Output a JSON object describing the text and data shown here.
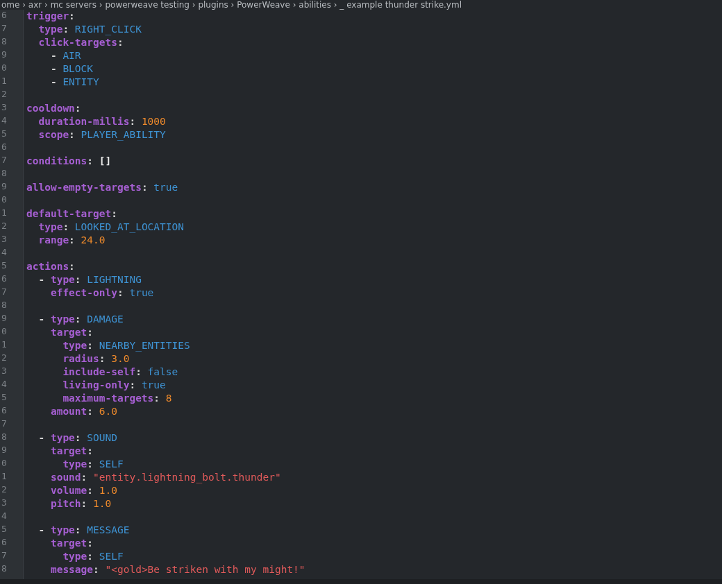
{
  "breadcrumb": "ome › axr › mc servers › powerweave testing › plugins › PowerWeave › abilities › _ example thunder strike.yml",
  "lines": [
    {
      "number": "6",
      "tokens": [
        {
          "kind": "key",
          "text": "trigger"
        },
        {
          "kind": "punct",
          "text": ":"
        }
      ]
    },
    {
      "number": "7",
      "tokens": [
        {
          "kind": "key",
          "text": "  type"
        },
        {
          "kind": "punct",
          "text": ": "
        },
        {
          "kind": "value",
          "text": "RIGHT_CLICK"
        }
      ]
    },
    {
      "number": "8",
      "tokens": [
        {
          "kind": "key",
          "text": "  click-targets"
        },
        {
          "kind": "punct",
          "text": ":"
        }
      ]
    },
    {
      "number": "9",
      "tokens": [
        {
          "kind": "punct",
          "text": "    - "
        },
        {
          "kind": "value",
          "text": "AIR"
        }
      ]
    },
    {
      "number": "0",
      "tokens": [
        {
          "kind": "punct",
          "text": "    - "
        },
        {
          "kind": "value",
          "text": "BLOCK"
        }
      ]
    },
    {
      "number": "1",
      "tokens": [
        {
          "kind": "punct",
          "text": "    - "
        },
        {
          "kind": "value",
          "text": "ENTITY"
        }
      ]
    },
    {
      "number": "2"
    },
    {
      "number": "3",
      "tokens": [
        {
          "kind": "key",
          "text": "cooldown"
        },
        {
          "kind": "punct",
          "text": ":"
        }
      ]
    },
    {
      "number": "4",
      "tokens": [
        {
          "kind": "key",
          "text": "  duration-millis"
        },
        {
          "kind": "punct",
          "text": ": "
        },
        {
          "kind": "number",
          "text": "1000"
        }
      ]
    },
    {
      "number": "5",
      "tokens": [
        {
          "kind": "key",
          "text": "  scope"
        },
        {
          "kind": "punct",
          "text": ": "
        },
        {
          "kind": "value",
          "text": "PLAYER_ABILITY"
        }
      ]
    },
    {
      "number": "6"
    },
    {
      "number": "7",
      "tokens": [
        {
          "kind": "key",
          "text": "conditions"
        },
        {
          "kind": "punct",
          "text": ": "
        },
        {
          "kind": "bracket",
          "text": "[]"
        }
      ]
    },
    {
      "number": "8"
    },
    {
      "number": "9",
      "tokens": [
        {
          "kind": "key",
          "text": "allow-empty-targets"
        },
        {
          "kind": "punct",
          "text": ": "
        },
        {
          "kind": "value",
          "text": "true"
        }
      ]
    },
    {
      "number": "0"
    },
    {
      "number": "1",
      "tokens": [
        {
          "kind": "key",
          "text": "default-target"
        },
        {
          "kind": "punct",
          "text": ":"
        }
      ]
    },
    {
      "number": "2",
      "tokens": [
        {
          "kind": "key",
          "text": "  type"
        },
        {
          "kind": "punct",
          "text": ": "
        },
        {
          "kind": "value",
          "text": "LOOKED_AT_LOCATION"
        }
      ]
    },
    {
      "number": "3",
      "tokens": [
        {
          "kind": "key",
          "text": "  range"
        },
        {
          "kind": "punct",
          "text": ": "
        },
        {
          "kind": "number",
          "text": "24.0"
        }
      ]
    },
    {
      "number": "4"
    },
    {
      "number": "5",
      "tokens": [
        {
          "kind": "key",
          "text": "actions"
        },
        {
          "kind": "punct",
          "text": ":"
        }
      ]
    },
    {
      "number": "6",
      "tokens": [
        {
          "kind": "punct",
          "text": "  - "
        },
        {
          "kind": "key",
          "text": "type"
        },
        {
          "kind": "punct",
          "text": ": "
        },
        {
          "kind": "value",
          "text": "LIGHTNING"
        }
      ]
    },
    {
      "number": "7",
      "tokens": [
        {
          "kind": "key",
          "text": "    effect-only"
        },
        {
          "kind": "punct",
          "text": ": "
        },
        {
          "kind": "value",
          "text": "true"
        }
      ]
    },
    {
      "number": "8"
    },
    {
      "number": "9",
      "tokens": [
        {
          "kind": "punct",
          "text": "  - "
        },
        {
          "kind": "key",
          "text": "type"
        },
        {
          "kind": "punct",
          "text": ": "
        },
        {
          "kind": "value",
          "text": "DAMAGE"
        }
      ]
    },
    {
      "number": "0",
      "tokens": [
        {
          "kind": "key",
          "text": "    target"
        },
        {
          "kind": "punct",
          "text": ":"
        }
      ]
    },
    {
      "number": "1",
      "tokens": [
        {
          "kind": "key",
          "text": "      type"
        },
        {
          "kind": "punct",
          "text": ": "
        },
        {
          "kind": "value",
          "text": "NEARBY_ENTITIES"
        }
      ]
    },
    {
      "number": "2",
      "tokens": [
        {
          "kind": "key",
          "text": "      radius"
        },
        {
          "kind": "punct",
          "text": ": "
        },
        {
          "kind": "number",
          "text": "3.0"
        }
      ]
    },
    {
      "number": "3",
      "tokens": [
        {
          "kind": "key",
          "text": "      include-self"
        },
        {
          "kind": "punct",
          "text": ": "
        },
        {
          "kind": "value",
          "text": "false"
        }
      ]
    },
    {
      "number": "4",
      "tokens": [
        {
          "kind": "key",
          "text": "      living-only"
        },
        {
          "kind": "punct",
          "text": ": "
        },
        {
          "kind": "value",
          "text": "true"
        }
      ]
    },
    {
      "number": "5",
      "tokens": [
        {
          "kind": "key",
          "text": "      maximum-targets"
        },
        {
          "kind": "punct",
          "text": ": "
        },
        {
          "kind": "number",
          "text": "8"
        }
      ]
    },
    {
      "number": "6",
      "tokens": [
        {
          "kind": "key",
          "text": "    amount"
        },
        {
          "kind": "punct",
          "text": ": "
        },
        {
          "kind": "number",
          "text": "6.0"
        }
      ]
    },
    {
      "number": "7"
    },
    {
      "number": "8",
      "tokens": [
        {
          "kind": "punct",
          "text": "  - "
        },
        {
          "kind": "key",
          "text": "type"
        },
        {
          "kind": "punct",
          "text": ": "
        },
        {
          "kind": "value",
          "text": "SOUND"
        }
      ]
    },
    {
      "number": "9",
      "tokens": [
        {
          "kind": "key",
          "text": "    target"
        },
        {
          "kind": "punct",
          "text": ":"
        }
      ]
    },
    {
      "number": "0",
      "tokens": [
        {
          "kind": "key",
          "text": "      type"
        },
        {
          "kind": "punct",
          "text": ": "
        },
        {
          "kind": "value",
          "text": "SELF"
        }
      ]
    },
    {
      "number": "1",
      "tokens": [
        {
          "kind": "key",
          "text": "    sound"
        },
        {
          "kind": "punct",
          "text": ": "
        },
        {
          "kind": "string",
          "text": "\"entity.lightning_bolt.thunder\""
        }
      ]
    },
    {
      "number": "2",
      "tokens": [
        {
          "kind": "key",
          "text": "    volume"
        },
        {
          "kind": "punct",
          "text": ": "
        },
        {
          "kind": "number",
          "text": "1.0"
        }
      ]
    },
    {
      "number": "3",
      "tokens": [
        {
          "kind": "key",
          "text": "    pitch"
        },
        {
          "kind": "punct",
          "text": ": "
        },
        {
          "kind": "number",
          "text": "1.0"
        }
      ]
    },
    {
      "number": "4"
    },
    {
      "number": "5",
      "tokens": [
        {
          "kind": "punct",
          "text": "  - "
        },
        {
          "kind": "key",
          "text": "type"
        },
        {
          "kind": "punct",
          "text": ": "
        },
        {
          "kind": "value",
          "text": "MESSAGE"
        }
      ]
    },
    {
      "number": "6",
      "tokens": [
        {
          "kind": "key",
          "text": "    target"
        },
        {
          "kind": "punct",
          "text": ":"
        }
      ]
    },
    {
      "number": "7",
      "tokens": [
        {
          "kind": "key",
          "text": "      type"
        },
        {
          "kind": "punct",
          "text": ": "
        },
        {
          "kind": "value",
          "text": "SELF"
        }
      ]
    },
    {
      "number": "8",
      "tokens": [
        {
          "kind": "key",
          "text": "    message"
        },
        {
          "kind": "punct",
          "text": ": "
        },
        {
          "kind": "string",
          "text": "\"<gold>Be striken with my might!\""
        }
      ]
    }
  ]
}
